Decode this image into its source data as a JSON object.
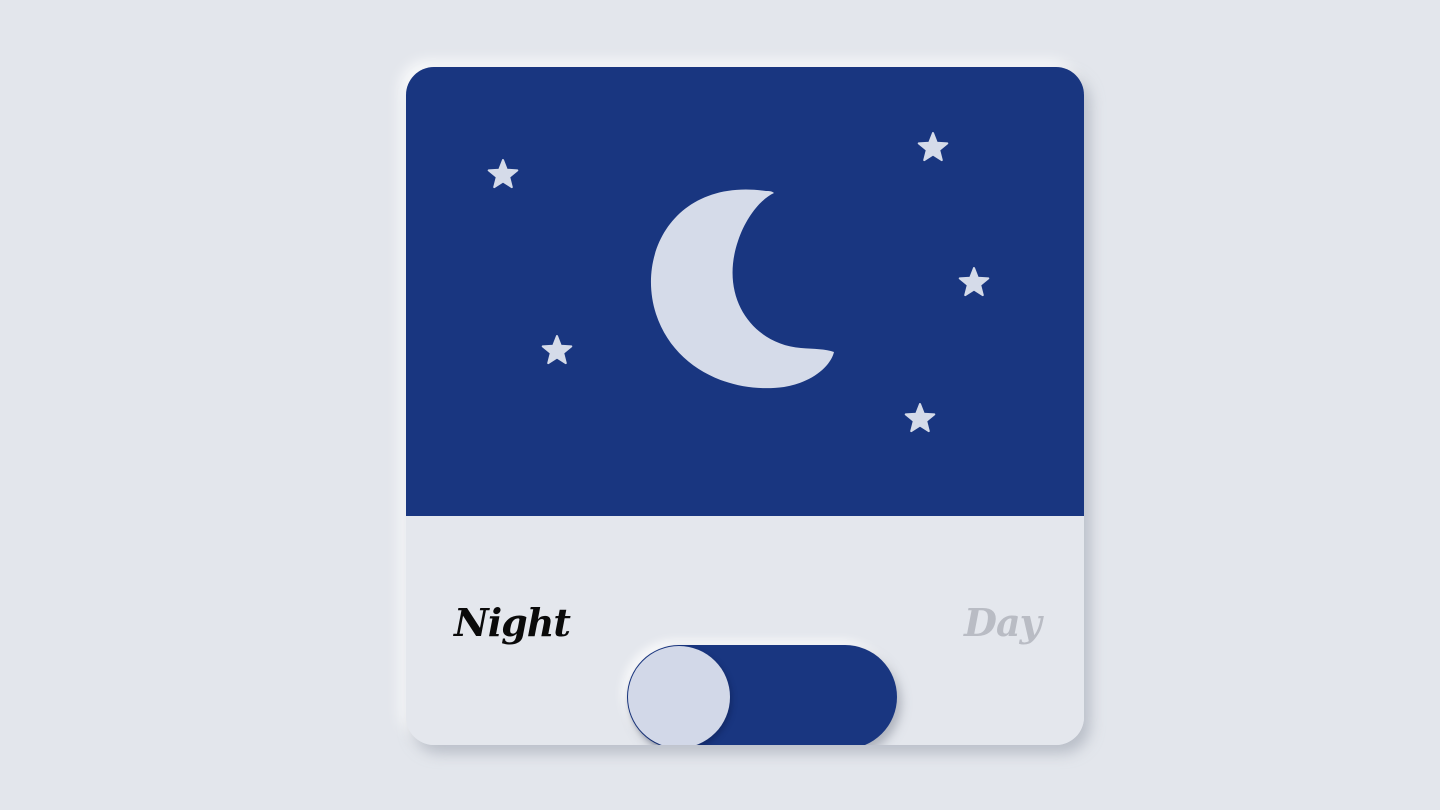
{
  "scene": {
    "mode": "night",
    "sky_color": "#193680",
    "moon_color": "#d5dbe9",
    "star_color": "#d5dbe9",
    "icons": [
      "moon-icon",
      "star-icon"
    ]
  },
  "toggle": {
    "left_label": "Night",
    "right_label": "Day",
    "active": "Night",
    "knob_position": 0,
    "track_color": "#193680",
    "knob_color": "#d2d8e8",
    "active_label_color": "#0a0a0a",
    "inactive_label_color": "#b9bcc4"
  }
}
